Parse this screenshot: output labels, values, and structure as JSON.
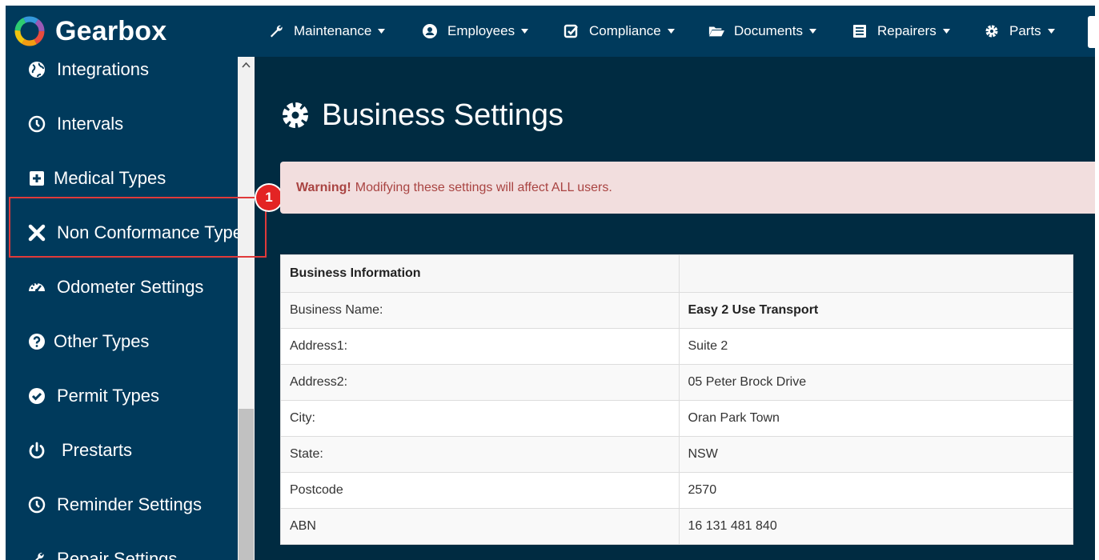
{
  "brand": {
    "name": "Gearbox"
  },
  "nav": {
    "maintenance": "Maintenance",
    "employees": "Employees",
    "compliance": "Compliance",
    "documents": "Documents",
    "repairers": "Repairers",
    "parts": "Parts"
  },
  "sidebar": {
    "items": [
      {
        "label": "Integrations",
        "icon": "globe-icon"
      },
      {
        "label": "Intervals",
        "icon": "clock-icon"
      },
      {
        "label": "Medical Types",
        "icon": "plus-square-icon"
      },
      {
        "label": "Non Conformance Types",
        "icon": "x-icon"
      },
      {
        "label": "Odometer Settings",
        "icon": "dashboard-icon"
      },
      {
        "label": "Other Types",
        "icon": "question-circle-icon"
      },
      {
        "label": "Permit Types",
        "icon": "check-circle-icon"
      },
      {
        "label": "Prestarts",
        "icon": "power-icon"
      },
      {
        "label": "Reminder Settings",
        "icon": "clock-icon"
      },
      {
        "label": "Repair Settings",
        "icon": "wrench-icon"
      }
    ]
  },
  "callout": {
    "number": "1"
  },
  "page": {
    "title": "Business Settings",
    "alert_strong": "Warning!",
    "alert_text": "Modifying these settings will affect ALL users."
  },
  "table": {
    "header": "Business Information",
    "rows": [
      {
        "label": "Business Name:",
        "value": "Easy 2 Use Transport"
      },
      {
        "label": "Address1:",
        "value": "Suite 2"
      },
      {
        "label": "Address2:",
        "value": "05 Peter Brock Drive"
      },
      {
        "label": "City:",
        "value": "Oran Park Town"
      },
      {
        "label": "State:",
        "value": "NSW"
      },
      {
        "label": "Postcode",
        "value": "2570"
      },
      {
        "label": "ABN",
        "value": "16 131 481 840"
      }
    ]
  },
  "colors": {
    "navbar": "#003a5c",
    "main_bg": "#002b41",
    "alert_bg": "#f2dede",
    "alert_text": "#a94442",
    "callout": "#e32424"
  }
}
